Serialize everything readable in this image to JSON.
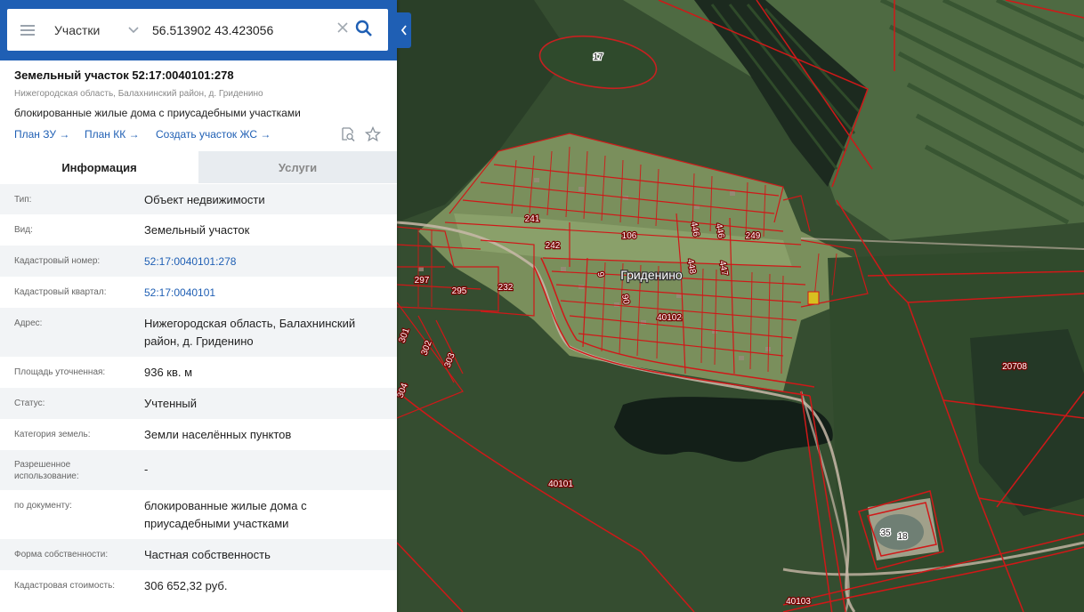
{
  "search": {
    "layer": "Участки",
    "query": "56.513902 43.423056"
  },
  "parcel": {
    "title": "Земельный участок 52:17:0040101:278",
    "address_sub": "Нижегородская область, Балахнинский район, д. Гриденино",
    "purpose": "блокированные жилые дома с приусадебными участками",
    "links": [
      "План ЗУ →",
      "План КК →",
      "Создать участок ЖС →"
    ]
  },
  "tabs": [
    "Информация",
    "Услуги"
  ],
  "info": [
    {
      "label": "Тип:",
      "value": "Объект недвижимости"
    },
    {
      "label": "Вид:",
      "value": "Земельный участок"
    },
    {
      "label": "Кадастровый номер:",
      "value": "52:17:0040101:278"
    },
    {
      "label": "Кадастровый квартал:",
      "value": "52:17:0040101"
    },
    {
      "label": "Адрес:",
      "value": "Нижегородская область, Балахнинский район, д. Гриденино"
    },
    {
      "label": "Площадь уточненная:",
      "value": "936 кв. м"
    },
    {
      "label": "Статус:",
      "value": "Учтенный"
    },
    {
      "label": "Категория земель:",
      "value": "Земли населённых пунктов"
    },
    {
      "label": "Разрешенное использование:",
      "value": "-"
    },
    {
      "label": "по документу:",
      "value": "блокированные жилые дома с приусадебными участками"
    },
    {
      "label": "Форма собственности:",
      "value": "Частная собственность"
    },
    {
      "label": "Кадастровая стоимость:",
      "value": "306 652,32 руб."
    }
  ],
  "map": {
    "place_name": "Гриденино",
    "labels": [
      "17",
      "241",
      "242",
      "106",
      "446",
      "446",
      "249",
      "448",
      "447",
      "9",
      "90",
      "297",
      "295",
      "232",
      "40102",
      "301",
      "302",
      "303",
      "304",
      "20708",
      "40101",
      "35",
      "18",
      "40103"
    ],
    "colors": {
      "boundary": "#d01818",
      "forest": "#2d4a2a",
      "field": "#6f8a55",
      "water": "#14241c",
      "highlight": "#d8c020"
    }
  }
}
